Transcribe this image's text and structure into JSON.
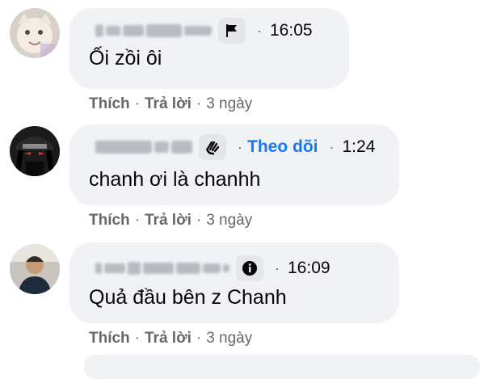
{
  "comments": [
    {
      "text": "Ối zồi ôi",
      "time": "16:05",
      "dot": "·",
      "badge_icon": "flag-icon",
      "actions": {
        "like": "Thích",
        "reply": "Trả lời",
        "age": "3 ngày",
        "sep": "·"
      }
    },
    {
      "text": "chanh ơi là chanhh",
      "time": "1:24",
      "dot": "·",
      "follow": "Theo dõi",
      "badge_icon": "wave-hand-icon",
      "actions": {
        "like": "Thích",
        "reply": "Trả lời",
        "age": "3 ngày",
        "sep": "·"
      }
    },
    {
      "text": "Quả đầu bên z Chanh",
      "time": "16:09",
      "dot": "·",
      "badge_icon": "info-badge-icon",
      "actions": {
        "like": "Thích",
        "reply": "Trả lời",
        "age": "3 ngày",
        "sep": "·"
      }
    }
  ],
  "colors": {
    "bubble": "#f0f2f5",
    "link": "#1877f2",
    "secondary_text": "#65676b",
    "primary_text": "#050505"
  }
}
